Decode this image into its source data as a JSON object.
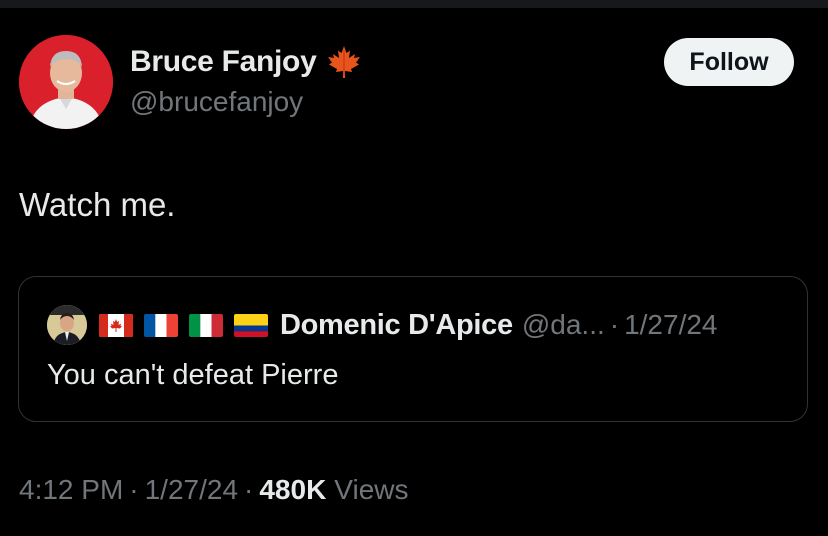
{
  "author": {
    "display_name": "Bruce Fanjoy",
    "handle": "@brucefanjoy",
    "badge_icon": "maple-leaf-icon"
  },
  "follow_button": {
    "label": "Follow"
  },
  "tweet": {
    "text": "Watch me."
  },
  "quoted_tweet": {
    "flags": [
      "canada-flag-icon",
      "france-flag-icon",
      "italy-flag-icon",
      "colombia-flag-icon"
    ],
    "display_name": "Domenic D'Apice",
    "handle": "@da...",
    "separator": "·",
    "date": "1/27/24",
    "text": "You can't defeat Pierre"
  },
  "meta": {
    "time": "4:12 PM",
    "separator": "·",
    "date": "1/27/24",
    "views_count": "480K",
    "views_label": "Views"
  },
  "colors": {
    "background": "#000000",
    "primary_text": "#e7e9ea",
    "secondary_text": "#71767b",
    "border": "#2f3336",
    "button_bg": "#eff3f4"
  }
}
